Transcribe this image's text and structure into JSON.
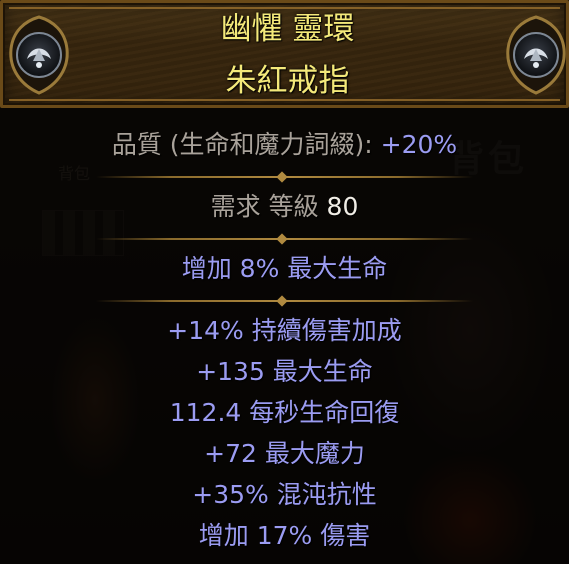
{
  "item": {
    "name": "幽懼 靈環",
    "base_type": "朱紅戒指",
    "rarity_color": "#f4e97a"
  },
  "quality": {
    "label": "品質 (生命和魔力詞綴):",
    "value": "+20%",
    "value_color": "#9b9cf2"
  },
  "requirements": {
    "label": "需求 等級",
    "value": "80"
  },
  "implicit_mods": [
    "增加 8% 最大生命"
  ],
  "explicit_mods": [
    "+14% 持續傷害加成",
    "+135 最大生命",
    "112.4 每秒生命回復",
    "+72 最大魔力",
    "+35% 混沌抗性",
    "增加 17% 傷害"
  ],
  "background": {
    "panel_word": "背包",
    "panel_small_word": "背包"
  },
  "icons": {
    "left_emblem": "shaper-sigil-icon",
    "right_emblem": "shaper-sigil-icon"
  },
  "colors": {
    "header_border": "#6a4a18",
    "mod_text": "#9b9cf2",
    "label_text": "#a9a29a"
  }
}
